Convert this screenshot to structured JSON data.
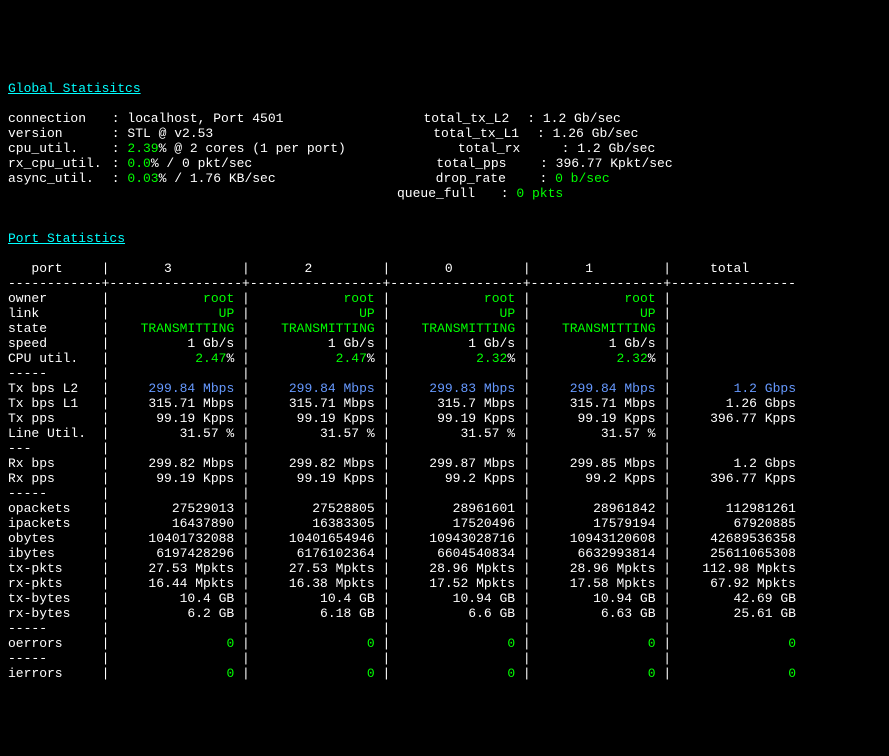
{
  "headers": {
    "global": "Global Statisitcs",
    "port": "Port Statistics"
  },
  "global": {
    "left_labels": [
      "connection",
      "version",
      "cpu_util.",
      "rx_cpu_util.",
      "async_util."
    ],
    "connection": "localhost, Port 4501",
    "version": "STL @ v2.53",
    "cpu_util_pct": "2.39",
    "cpu_util_suffix": "% @ 2 cores (1 per port)",
    "rx_cpu_util_pct": "0.0",
    "rx_cpu_util_suffix": "% / 0 pkt/sec",
    "async_util_pct": "0.03",
    "async_util_suffix": "% / 1.76 KB/sec",
    "right_labels": [
      "total_tx_L2",
      "total_tx_L1",
      "total_rx",
      "total_pps",
      "drop_rate",
      "queue_full"
    ],
    "total_tx_L2": "1.2 Gb/sec",
    "total_tx_L1": "1.26 Gb/sec",
    "total_rx": "1.2 Gb/sec",
    "total_pps": "396.77 Kpkt/sec",
    "drop_rate": "0 b/sec",
    "queue_full": "0 pkts"
  },
  "cols": {
    "port": "port",
    "c0": "3",
    "c1": "2",
    "c2": "0",
    "c3": "1",
    "total": "total"
  },
  "row_labels": {
    "owner": "owner",
    "link": "link",
    "state": "state",
    "speed": "speed",
    "cpu": "CPU util.",
    "txl2": "Tx bps L2",
    "txl1": "Tx bps L1",
    "txpps": "Tx pps",
    "lineu": "Line Util.",
    "rxbps": "Rx bps",
    "rxpps": "Rx pps",
    "opkt": "opackets",
    "ipkt": "ipackets",
    "obyt": "obytes",
    "ibyt": "ibytes",
    "txpk": "tx-pkts",
    "rxpk": "rx-pkts",
    "txby": "tx-bytes",
    "rxby": "rx-bytes",
    "oerr": "oerrors",
    "ierr": "ierrors",
    "dash": "---",
    "dashdash": "-----"
  },
  "ports": {
    "owner": [
      "root",
      "root",
      "root",
      "root",
      ""
    ],
    "link": [
      "UP",
      "UP",
      "UP",
      "UP",
      ""
    ],
    "state": [
      "TRANSMITTING",
      "TRANSMITTING",
      "TRANSMITTING",
      "TRANSMITTING",
      ""
    ],
    "speed": [
      "1 Gb/s",
      "1 Gb/s",
      "1 Gb/s",
      "1 Gb/s",
      ""
    ],
    "cpu_v": [
      "2.47",
      "2.47",
      "2.32",
      "2.32",
      ""
    ],
    "txl2": [
      "299.84 Mbps",
      "299.84 Mbps",
      "299.83 Mbps",
      "299.84 Mbps",
      "1.2 Gbps"
    ],
    "txl1": [
      "315.71 Mbps",
      "315.71 Mbps",
      "315.7 Mbps",
      "315.71 Mbps",
      "1.26 Gbps"
    ],
    "txpps": [
      "99.19 Kpps",
      "99.19 Kpps",
      "99.19 Kpps",
      "99.19 Kpps",
      "396.77 Kpps"
    ],
    "lineu": [
      "31.57 %",
      "31.57 %",
      "31.57 %",
      "31.57 %",
      ""
    ],
    "rxbps": [
      "299.82 Mbps",
      "299.82 Mbps",
      "299.87 Mbps",
      "299.85 Mbps",
      "1.2 Gbps"
    ],
    "rxpps": [
      "99.19 Kpps",
      "99.19 Kpps",
      "99.2 Kpps",
      "99.2 Kpps",
      "396.77 Kpps"
    ],
    "opkt": [
      "27529013",
      "27528805",
      "28961601",
      "28961842",
      "112981261"
    ],
    "ipkt": [
      "16437890",
      "16383305",
      "17520496",
      "17579194",
      "67920885"
    ],
    "obyt": [
      "10401732088",
      "10401654946",
      "10943028716",
      "10943120608",
      "42689536358"
    ],
    "ibyt": [
      "6197428296",
      "6176102364",
      "6604540834",
      "6632993814",
      "25611065308"
    ],
    "txpk": [
      "27.53 Mpkts",
      "27.53 Mpkts",
      "28.96 Mpkts",
      "28.96 Mpkts",
      "112.98 Mpkts"
    ],
    "rxpk": [
      "16.44 Mpkts",
      "16.38 Mpkts",
      "17.52 Mpkts",
      "17.58 Mpkts",
      "67.92 Mpkts"
    ],
    "txby": [
      "10.4 GB",
      "10.4 GB",
      "10.94 GB",
      "10.94 GB",
      "42.69 GB"
    ],
    "rxby": [
      "6.2 GB",
      "6.18 GB",
      "6.6 GB",
      "6.63 GB",
      "25.61 GB"
    ],
    "oerr": [
      "0",
      "0",
      "0",
      "0",
      "0"
    ],
    "ierr": [
      "0",
      "0",
      "0",
      "0",
      "0"
    ]
  },
  "pct": "%"
}
